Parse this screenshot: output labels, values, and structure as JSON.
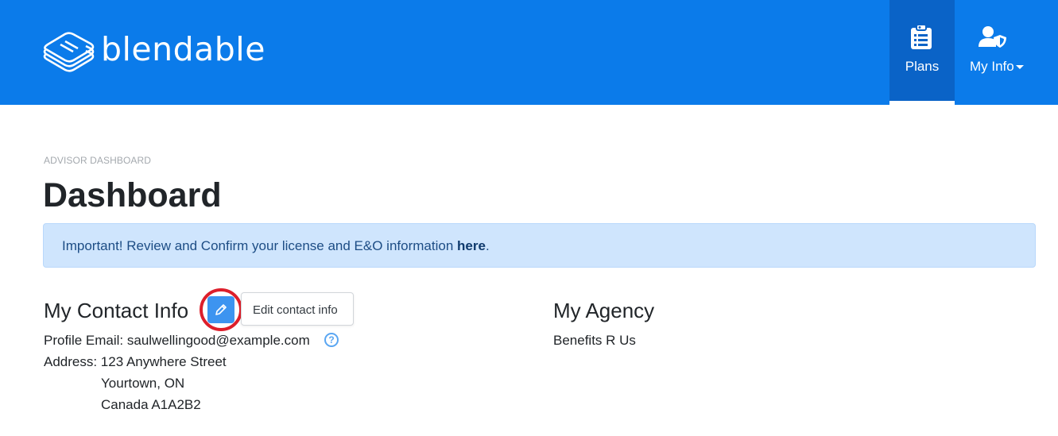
{
  "header": {
    "brand": "blendable",
    "background_color": "#0b7bea",
    "active_tab_color": "#0a63c7",
    "nav": {
      "plans": {
        "label": "Plans",
        "icon": "clipboard-list-icon",
        "active": true
      },
      "my_info": {
        "label": "My Info",
        "icon": "user-shield-icon",
        "dropdown": true
      }
    }
  },
  "breadcrumb": "ADVISOR DASHBOARD",
  "page_title": "Dashboard",
  "alert": {
    "text": "Important! Review and Confirm your license and E&O information ",
    "link": "here",
    "suffix": "."
  },
  "contact": {
    "title": "My Contact Info",
    "edit_tooltip": "Edit contact info",
    "email_line": "Profile Email: saulwellingood@example.com",
    "address_label": "Address: 123 Anywhere Street",
    "address_city": "Yourtown, ON",
    "address_country": "Canada A1A2B2",
    "help_glyph": "?"
  },
  "agency": {
    "title": "My Agency",
    "name": "Benefits R Us"
  },
  "colors": {
    "highlight": "#dd1f2b",
    "edit_button": "#3d94f0",
    "alert_bg": "#cfe5fd"
  }
}
